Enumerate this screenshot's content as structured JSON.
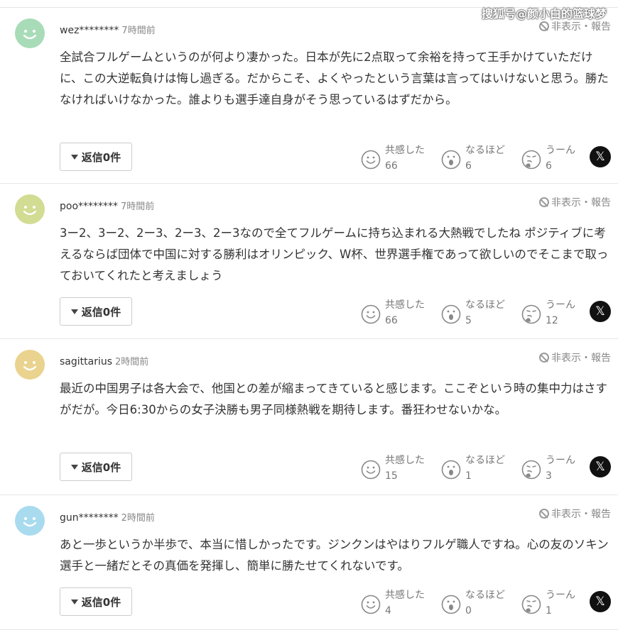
{
  "watermark": "搜狐号@颜小白的篮球梦",
  "labels": {
    "hide_report": "非表示・報告",
    "reply": "返信0件",
    "reaction_empathy": "共感した",
    "reaction_insight": "なるほど",
    "reaction_doubt": "うーん",
    "x_share": "𝕏"
  },
  "colors": {
    "avatar_green": "#a8dcb8",
    "avatar_olive": "#d2dc92",
    "avatar_yellow": "#ead38e",
    "avatar_blue": "#a9dbef"
  },
  "comments": [
    {
      "username": "wez********",
      "time": "7時間前",
      "avatar_color": "#a8dcb8",
      "body": "全試合フルゲームというのが何より凄かった。日本が先に2点取って余裕を持って王手かけていただけに、この大逆転負けは悔し過ぎる。だからこそ、よくやったという言葉は言ってはいけないと思う。勝たなければいけなかった。誰よりも選手達自身がそう思っているはずだから。",
      "empathy": "66",
      "insight": "6",
      "doubt": "6"
    },
    {
      "username": "poo********",
      "time": "7時間前",
      "avatar_color": "#d2dc92",
      "body": "3ー2、3ー2、2ー3、2ー3、2ー3なので全てフルゲームに持ち込まれる大熱戦でしたね ポジティブに考えるならば団体で中国に対する勝利はオリンピック、W杯、世界選手権であって欲しいのでそこまで取っておいてくれたと考えましょう",
      "empathy": "66",
      "insight": "5",
      "doubt": "12"
    },
    {
      "username": "sagittarius",
      "time": "2時間前",
      "avatar_color": "#ead38e",
      "body": "最近の中国男子は各大会で、他国との差が縮まってきていると感じます。ここぞという時の集中力はさすがだが。今日6:30からの女子決勝も男子同様熱戦を期待します。番狂わせないかな。",
      "empathy": "15",
      "insight": "1",
      "doubt": "3"
    },
    {
      "username": "gun********",
      "time": "2時間前",
      "avatar_color": "#a9dbef",
      "body": "あと一歩というか半歩で、本当に惜しかったです。ジンクンはやはりフルゲ職人ですね。心の友のソキン選手と一緒だとその真価を発揮し、簡単に勝たせてくれないです。",
      "empathy": "4",
      "insight": "0",
      "doubt": "1"
    }
  ]
}
